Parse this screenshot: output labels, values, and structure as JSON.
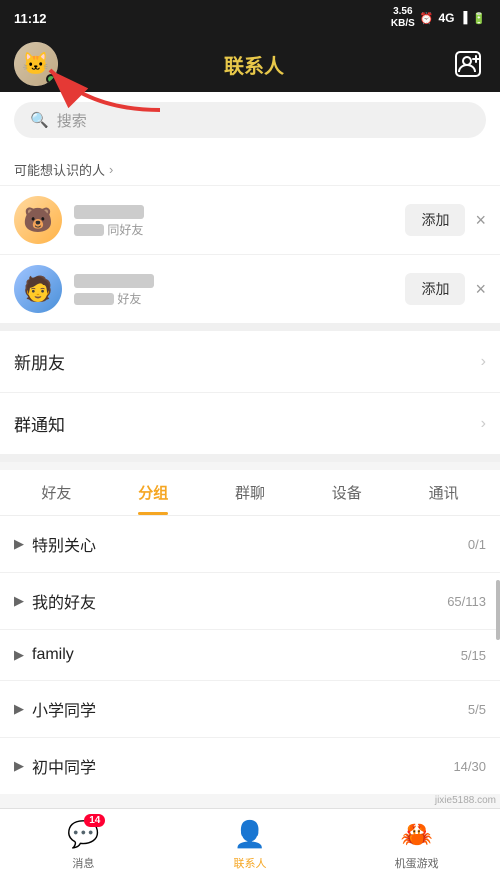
{
  "statusBar": {
    "time": "11:12",
    "speed": "3.56\nKB/S",
    "icons": [
      "alarm",
      "4G",
      "signal",
      "battery"
    ]
  },
  "header": {
    "title": "联系人",
    "addLabel": "+"
  },
  "search": {
    "placeholder": "搜索"
  },
  "mayKnow": {
    "sectionLabel": "可能想认识的人",
    "chevron": ">",
    "items": [
      {
        "nameBlurred": true,
        "subText": "同好友",
        "addLabel": "添加",
        "closeLabel": "×"
      },
      {
        "nameBlurred": true,
        "subText": "好友",
        "addLabel": "添加",
        "closeLabel": "×"
      }
    ]
  },
  "menuItems": [
    {
      "label": "新朋友",
      "chevron": "›"
    },
    {
      "label": "群通知",
      "chevron": "›"
    }
  ],
  "tabs": [
    {
      "label": "好友",
      "active": false
    },
    {
      "label": "分组",
      "active": true
    },
    {
      "label": "群聊",
      "active": false
    },
    {
      "label": "设备",
      "active": false
    },
    {
      "label": "通讯",
      "active": false
    }
  ],
  "groups": [
    {
      "name": "特别关心",
      "count": "0/1"
    },
    {
      "name": "我的好友",
      "count": "65/113"
    },
    {
      "name": "family",
      "count": "5/15"
    },
    {
      "name": "小学同学",
      "count": "5/5"
    },
    {
      "name": "初中同学",
      "count": "14/30"
    }
  ],
  "bottomNav": [
    {
      "label": "消息",
      "badge": "14",
      "icon": "💬",
      "active": false
    },
    {
      "label": "联系人",
      "badge": "",
      "icon": "👤",
      "active": true
    },
    {
      "label": "机蛋游戏",
      "badge": "",
      "icon": "🦀",
      "active": false
    }
  ],
  "watermark": "jixie5188.com"
}
